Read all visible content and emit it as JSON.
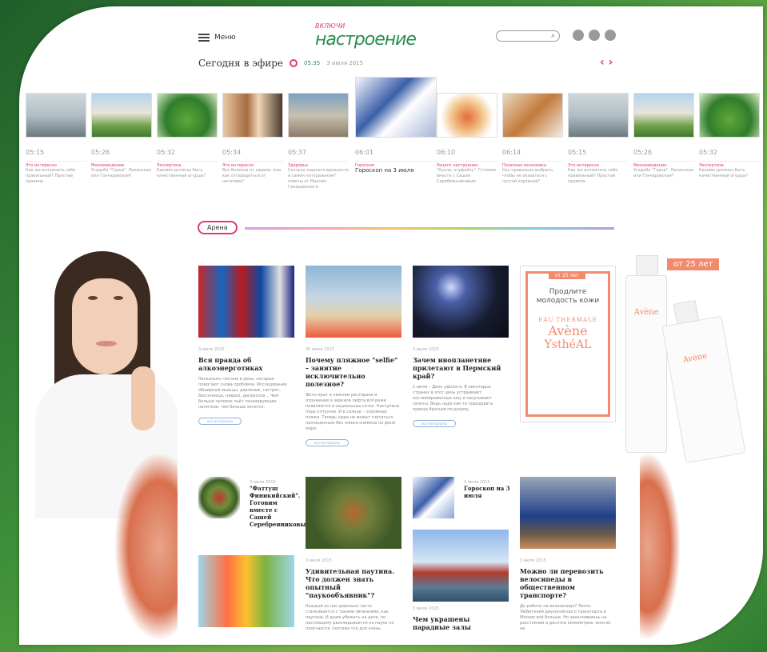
{
  "header": {
    "menu_label": "Меню",
    "logo_sup": "ВКЛЮЧИ",
    "logo_main": "настроение",
    "on_air_title": "Сегодня в эфире",
    "on_air_time": "05:35",
    "on_air_date": "3 июля 2015"
  },
  "strip": [
    {
      "time": "05:15",
      "cat": "Это интересно",
      "text": "Как же вспомнить себе правильный? Простые правила",
      "img": "plane"
    },
    {
      "time": "05:26",
      "cat": "Москвоведение",
      "text": "Усадьба \"Горки\". Ленинская или Гончаровская?",
      "img": "house"
    },
    {
      "time": "05:32",
      "cat": "Экспертиза",
      "text": "Какими должны быть качественный огурцы?",
      "img": "cuke"
    },
    {
      "time": "05:34",
      "cat": "Это интересно",
      "text": "Все болезни от нервов: или как отгородиться от негатива?",
      "img": "women"
    },
    {
      "time": "05:37",
      "cat": "Здоровье",
      "text": "Сколько лишнего вредности в самом натуральном? советы от Максим Ганишевского",
      "img": "box"
    },
    {
      "time": "06:01",
      "cat": "Гороскоп",
      "text": "Гороскоп на 3 июля",
      "img": "horo"
    },
    {
      "time": "06:10",
      "cat": "Рецепт настроения",
      "text": "\"Кукла, огуфейку\". Готовим вместе с Сашей Серебрянниковым",
      "img": "food"
    },
    {
      "time": "06:14",
      "cat": "Полезная экономика",
      "text": "Как правильно выбрать, чтобы не оказаться с пустой корзиной?",
      "img": "mix"
    },
    {
      "time": "05:15",
      "cat": "Это интересно",
      "text": "Как же вспомнить себе правильный? Простые правила",
      "img": "plane"
    },
    {
      "time": "05:26",
      "cat": "Москвоведение",
      "text": "Усадьба \"Горки\". Ленинская или Гончаровская?",
      "img": "house"
    },
    {
      "time": "05:32",
      "cat": "Экспертиза",
      "text": "Какими должны быть качественный огурцы?",
      "img": "cuke"
    }
  ],
  "arena_label": "Арена",
  "cards": [
    {
      "date": "3 июля 2015",
      "title": "Вся правда об алкоэнерготиках",
      "text": "Несколько глотков в день, которые помогают снова проблема. Исследование обширный мышцы, давление, гастрит, бессонница, невроз, депрессия… Чем больше человек пьёт тонизирующих напитков, тем больше хочется.",
      "more": "все материалы"
    },
    {
      "date": "30 июня 2015",
      "title": "Почему пляжное \"selfie\" – занятие исключительно полезное?",
      "text": "Фото-прыг в нижнем ресторане и отражение в зеркале лифта всё реже появляются в социальных сетях. Наступила пора отпусков. И в солнце – огромные пляжи. Теперь сюда не может считаться полноценным без пляжа снимков на фоне моря.",
      "more": "все материалы"
    },
    {
      "date": "3 июля 2015",
      "title": "Зачем инопланетяне прилетают в Пермский край?",
      "text": "2 июля – День уфолога. В некоторых странах в этот день устраивают костюмированные шоу и закусывают салаты. Ведь надо как-то порадовать приезд братьев по разуму.",
      "more": "все материалы"
    }
  ],
  "row2": {
    "salad_title": "\"Фаттуш Финикийский\". Готовим вместе с Сашей Серебренниковым",
    "salad_date": "3 июля 2015",
    "horo_title": "Гороскоп на 3 июля",
    "horo_date": "3 июля 2015",
    "spider_date": "3 июля 2015",
    "spider_title": "Удивительная паутина. Что должен знать опытный \"паукообъявник\"?",
    "spider_text": "Каждый из нас довольно часто сталкивается с такими явлениями, как паутина. И даже убежать на даче, по настоящему раскладывается на паука не получается, поэтому что для очень",
    "kremlin_date": "3 июля 2015",
    "kremlin_title": "Чем украшены парадные залы",
    "couple_date": "3 июля 2015",
    "couple_title": "Можно ли перевозить велосипеды в общественном транспорте?",
    "couple_text": "До работы на велосипеде? Легко. Любителей двухколёсного транспорта в Москве всё больше. Но заканчиваешь на расстоянии в десятки километров, многие не"
  },
  "ad": {
    "tag": "от 25 лет",
    "line1": "Продлите",
    "line2": "молодость кожи",
    "brand1": "EAU THERMALE",
    "brand2": "Avène",
    "brand3": "YsthéAL",
    "big_tag": "от 25 лет",
    "bottle_label": "Avène"
  },
  "colors": {
    "accent": "#e23a6d",
    "brand_green": "#2a8d52",
    "ad_peach": "#f28b6e"
  }
}
